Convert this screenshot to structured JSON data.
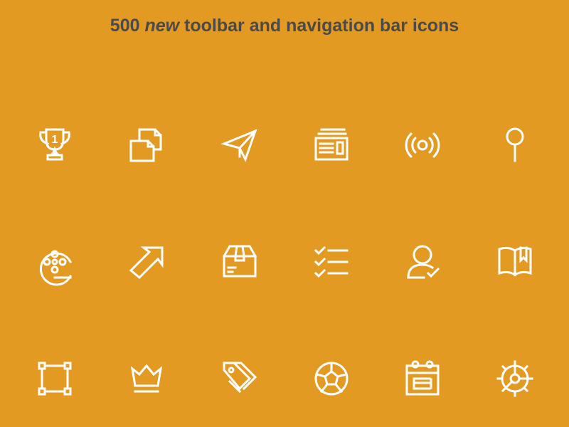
{
  "header": {
    "title_prefix": "500 ",
    "title_emphasis": "new",
    "title_suffix": " toolbar and navigation bar icons"
  },
  "colors": {
    "background": "#E39A22",
    "title": "#4A4A4A",
    "icon_stroke": "#FFFFFF"
  },
  "icons": [
    "trophy-icon",
    "documents-icon",
    "paper-plane-icon",
    "newspaper-icon",
    "broadcast-icon",
    "pushpin-icon",
    "film-reel-icon",
    "arrow-up-right-icon",
    "box-icon",
    "checklist-icon",
    "user-check-icon",
    "book-bookmark-icon",
    "crop-frame-icon",
    "crown-icon",
    "tags-icon",
    "soccer-ball-icon",
    "calendar-icon",
    "settings-gear-icon"
  ],
  "trophy_number": "1"
}
